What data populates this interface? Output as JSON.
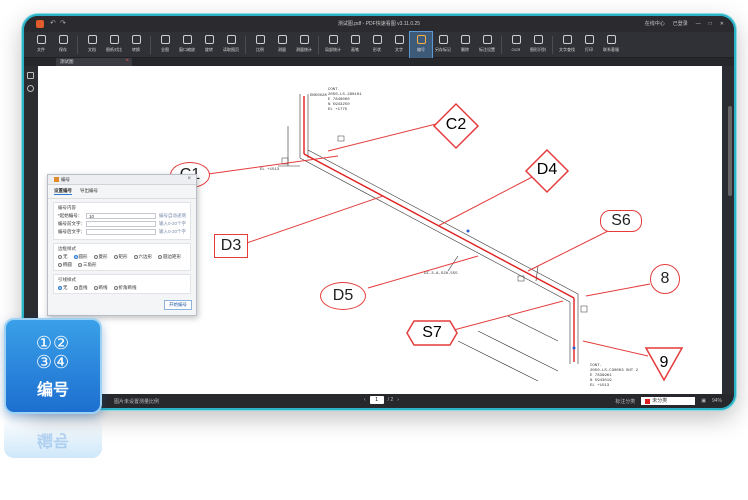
{
  "window": {
    "title": "测试图.pdf - PDF快速看图 v3.11.0.25",
    "right_items": [
      "在线中心",
      "已登录"
    ]
  },
  "toolbar": [
    {
      "label": "文件",
      "icon": "file-icon"
    },
    {
      "label": "保存",
      "icon": "save-icon"
    },
    {
      "label": "文档",
      "icon": "document-icon"
    },
    {
      "label": "图纸对比",
      "icon": "compare-icon"
    },
    {
      "label": "转换",
      "icon": "convert-icon"
    },
    {
      "label": "全图",
      "icon": "fit-all-icon"
    },
    {
      "label": "窗口缩放",
      "icon": "zoom-window-icon"
    },
    {
      "label": "旋转",
      "icon": "rotate-icon"
    },
    {
      "label": "读取图页",
      "icon": "read-page-icon"
    },
    {
      "label": "比例",
      "icon": "scale-icon"
    },
    {
      "label": "测量",
      "icon": "measure-icon"
    },
    {
      "label": "测量统计",
      "icon": "measure-stats-icon"
    },
    {
      "label": "局部统计",
      "icon": "partial-stats-icon"
    },
    {
      "label": "画笔",
      "icon": "pen-icon"
    },
    {
      "label": "形状",
      "icon": "shape-icon"
    },
    {
      "label": "文字",
      "icon": "text-icon"
    },
    {
      "label": "编号",
      "icon": "numbering-icon"
    },
    {
      "label": "另存标记",
      "icon": "save-markup-icon"
    },
    {
      "label": "删除",
      "icon": "delete-icon"
    },
    {
      "label": "标注设置",
      "icon": "markup-settings-icon"
    },
    {
      "label": "OCR",
      "icon": "ocr-icon"
    },
    {
      "label": "图形识别",
      "icon": "shape-recognize-icon"
    },
    {
      "label": "文字查找",
      "icon": "text-search-icon"
    },
    {
      "label": "打印",
      "icon": "print-icon"
    },
    {
      "label": "联系客服",
      "icon": "support-icon"
    }
  ],
  "active_tool": "编号",
  "tab": {
    "label": "测试图"
  },
  "dialog": {
    "title": "编号",
    "tabs": [
      "设置编号",
      "导出编号"
    ],
    "content_group": "编号内容",
    "start_label": "*起始编号：",
    "start_value": "10",
    "start_hint": "编号自动递增",
    "prefix_label": "编号前文字：",
    "prefix_hint": "输入0-20个字",
    "suffix_label": "编号后文字：",
    "suffix_hint": "输入0-20个字",
    "border_group": "边框样式",
    "border_options": [
      "无",
      "圆形",
      "菱形",
      "矩形",
      "六边形",
      "圆边矩形",
      "椭圆",
      "三角形"
    ],
    "border_selected": "圆形",
    "leader_group": "引线样式",
    "leader_options": [
      "无",
      "直线",
      "断线",
      "折角断线"
    ],
    "leader_selected": "无",
    "start_button": "开始编号"
  },
  "callouts": [
    {
      "text": "C1",
      "shape": "ellipse"
    },
    {
      "text": "C2",
      "shape": "diamond"
    },
    {
      "text": "D3",
      "shape": "rect"
    },
    {
      "text": "D4",
      "shape": "diamond"
    },
    {
      "text": "D5",
      "shape": "ellipse"
    },
    {
      "text": "S6",
      "shape": "rounded-rect"
    },
    {
      "text": "S7",
      "shape": "hexagon"
    },
    {
      "text": "8",
      "shape": "circle"
    },
    {
      "text": "9",
      "shape": "triangle"
    }
  ],
  "drawing_labels": {
    "top_block": [
      "CONT.",
      "2050-LS-280101",
      "E 7840000",
      "N 5943250",
      "EL +1775"
    ],
    "left_small": "EL +1513",
    "pipe_tag": "DZ-3-A-S28-555",
    "bottom_block": [
      "CONT.",
      "2050-LS-C30003 SHT 2",
      "E 7839961",
      "N 5943019",
      "EL +1513"
    ],
    "dn_label": "DN50X28"
  },
  "statusbar": {
    "left_text": "图片未设置测量比例",
    "page_current": "1",
    "page_total": "/ 2",
    "mark_label": "标注分类",
    "mark_value": "未分类",
    "zoom": "94%"
  },
  "badge": {
    "numbers": "①②\n③④",
    "label": "编号"
  },
  "colors": {
    "accent": "#e43c3c",
    "frame": "#2bb3c8",
    "badge": "#2a88e0"
  }
}
